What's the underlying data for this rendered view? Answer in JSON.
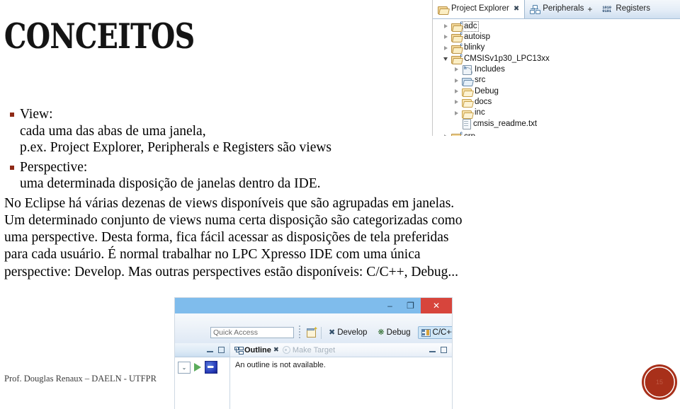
{
  "slide": {
    "title": "CONCEITOS",
    "footer": "Prof. Douglas Renaux – DAELN - UTFPR",
    "page_number": "15",
    "accent_color": "#8f2a16",
    "badge_color": "#a8301a"
  },
  "bullets": [
    {
      "heading": "View:",
      "lines": [
        "cada uma das abas de uma janela,",
        "p.ex. Project Explorer, Peripherals e Registers são views"
      ]
    },
    {
      "heading": "Perspective:",
      "lines": [
        "uma determinada disposição de janelas dentro da IDE."
      ]
    }
  ],
  "paragraph_lines": [
    "No Eclipse há várias dezenas de views disponíveis que são agrupadas em janelas.",
    "Um determinado conjunto de views numa certa disposição são categorizadas como",
    "uma perspective. Desta forma, fica fácil acessar as disposições de tela preferidas",
    "para cada usuário. É normal trabalhar no LPC Xpresso IDE com uma única",
    "perspective: Develop. Mas outras perspectives estão disponíveis: C/C++, Debug..."
  ],
  "project_explorer": {
    "tabs": [
      {
        "label": "Project Explorer",
        "icon": "folder-open-icon",
        "active": true,
        "closeable": true,
        "plus": false
      },
      {
        "label": "Peripherals",
        "icon": "peripherals-icon",
        "active": false,
        "closeable": false,
        "plus": true
      },
      {
        "label": "Registers",
        "icon": "registers-icon",
        "active": false,
        "closeable": false,
        "plus": false
      }
    ],
    "tree": [
      {
        "label": "adc",
        "indent": 0,
        "twisty": "collapsed",
        "icon": "project-folder-icon",
        "selected": true
      },
      {
        "label": "autoisp",
        "indent": 0,
        "twisty": "collapsed",
        "icon": "project-folder-icon",
        "selected": false
      },
      {
        "label": "blinky",
        "indent": 0,
        "twisty": "collapsed",
        "icon": "project-folder-icon",
        "selected": false
      },
      {
        "label": "CMSISv1p30_LPC13xx",
        "indent": 0,
        "twisty": "expanded",
        "icon": "project-folder-icon",
        "selected": false
      },
      {
        "label": "Includes",
        "indent": 1,
        "twisty": "collapsed",
        "icon": "includes-icon",
        "selected": false
      },
      {
        "label": "src",
        "indent": 1,
        "twisty": "collapsed",
        "icon": "source-folder-icon",
        "selected": false
      },
      {
        "label": "Debug",
        "indent": 1,
        "twisty": "collapsed",
        "icon": "folder-icon",
        "selected": false
      },
      {
        "label": "docs",
        "indent": 1,
        "twisty": "collapsed",
        "icon": "folder-icon",
        "selected": false
      },
      {
        "label": "inc",
        "indent": 1,
        "twisty": "collapsed",
        "icon": "folder-icon",
        "selected": false
      },
      {
        "label": "cmsis_readme.txt",
        "indent": 1,
        "twisty": "none",
        "icon": "text-file-icon",
        "selected": false
      },
      {
        "label": "crp",
        "indent": 0,
        "twisty": "collapsed",
        "icon": "project-folder-icon",
        "selected": false
      }
    ]
  },
  "eclipse_window": {
    "titlebar": {
      "minimize": "–",
      "restore": "❐",
      "close": "✕",
      "close_color": "#d7453c",
      "bar_color": "#7fbcec"
    },
    "quick_access": {
      "placeholder": "Quick Access",
      "value": ""
    },
    "perspective_buttons": [
      {
        "label": "Develop",
        "icon": "wrench-icon",
        "selected": false
      },
      {
        "label": "Debug",
        "icon": "bug-icon",
        "selected": false
      },
      {
        "label": "C/C++",
        "icon": "cpp-perspective-icon",
        "selected": true
      }
    ],
    "new_perspective_tooltip": "Open Perspective",
    "left_pane": {
      "minimize_label": "–",
      "maximize_label": "□",
      "dropdown_label": "⌄"
    },
    "outline_panel": {
      "tabs": [
        {
          "label": "Outline",
          "icon": "outline-icon",
          "active": true,
          "closeable": true
        },
        {
          "label": "Make Target",
          "icon": "make-target-icon",
          "active": false,
          "closeable": false
        }
      ],
      "message": "An outline is not available."
    }
  }
}
